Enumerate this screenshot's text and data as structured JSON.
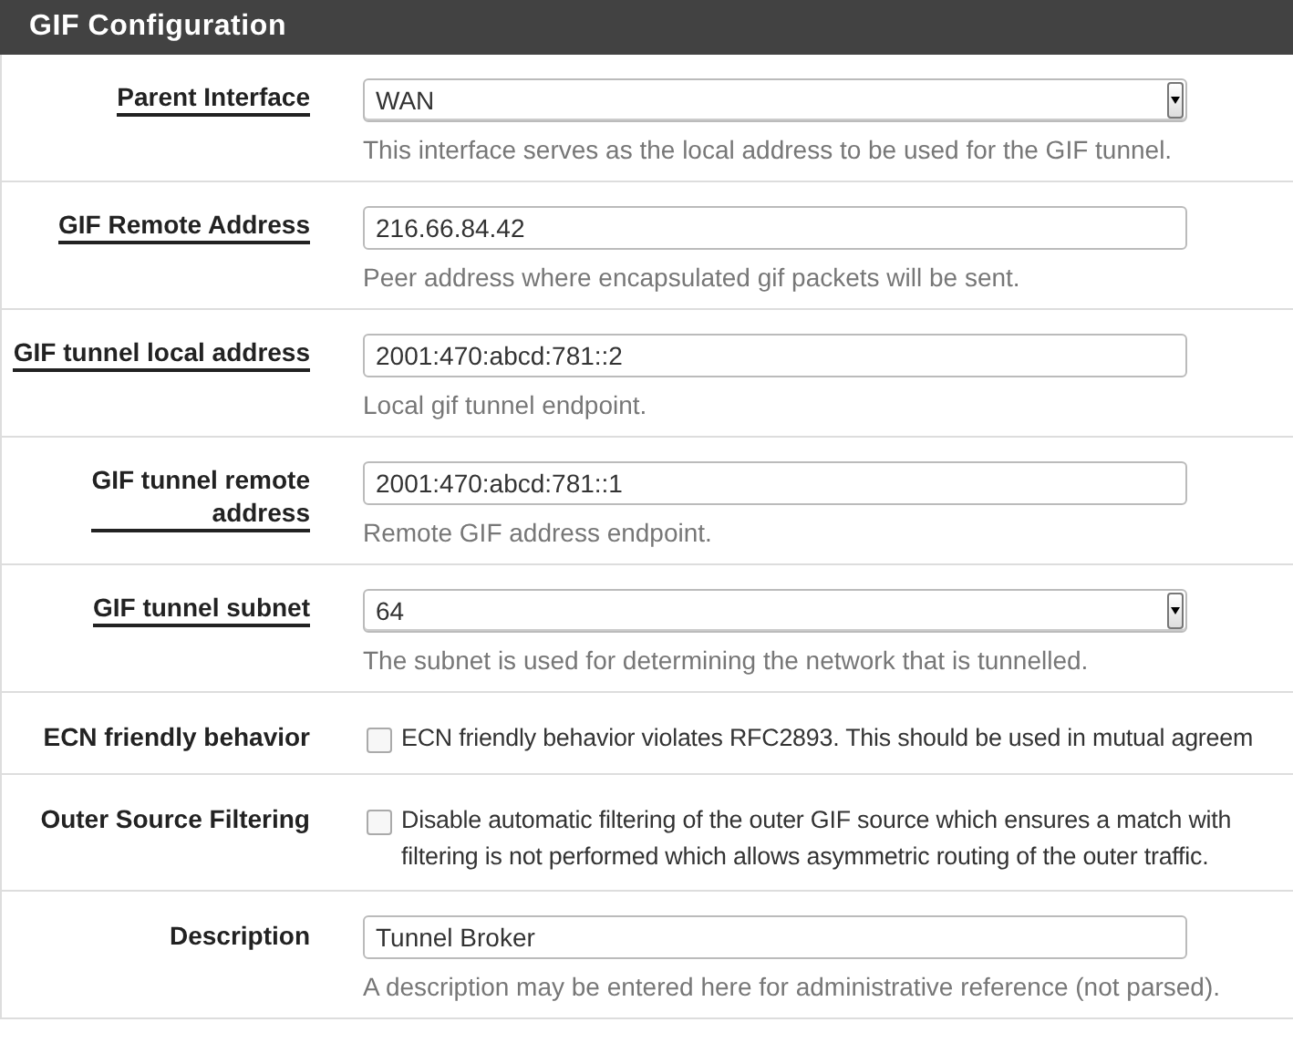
{
  "panel": {
    "title": "GIF Configuration"
  },
  "rows": [
    {
      "kind": "select",
      "label_lines": [
        "Parent Interface"
      ],
      "linked": true,
      "value": "WAN",
      "help": "This interface serves as the local address to be used for the GIF tunnel."
    },
    {
      "kind": "input",
      "label_lines": [
        "GIF Remote Address"
      ],
      "linked": true,
      "value": "216.66.84.42",
      "help": "Peer address where encapsulated gif packets will be sent."
    },
    {
      "kind": "input",
      "label_lines": [
        "GIF tunnel local address"
      ],
      "linked": true,
      "value": "2001:470:abcd:781::2",
      "help": "Local gif tunnel endpoint."
    },
    {
      "kind": "input",
      "label_lines": [
        "GIF tunnel remote",
        "address"
      ],
      "linked": true,
      "value": "2001:470:abcd:781::1",
      "help": "Remote GIF address endpoint."
    },
    {
      "kind": "select",
      "label_lines": [
        "GIF tunnel subnet"
      ],
      "linked": true,
      "value": "64",
      "help": "The subnet is used for determining the network that is tunnelled."
    },
    {
      "kind": "checkbox",
      "label_lines": [
        "ECN friendly behavior"
      ],
      "linked": false,
      "checked": false,
      "text_lines": [
        "ECN friendly behavior violates RFC2893. This should be used in mutual agreem"
      ]
    },
    {
      "kind": "checkbox",
      "label_lines": [
        "Outer Source Filtering"
      ],
      "linked": false,
      "checked": false,
      "text_lines": [
        "Disable automatic filtering of the outer GIF source which ensures a match with",
        "filtering is not performed which allows asymmetric routing of the outer traffic."
      ]
    },
    {
      "kind": "input",
      "label_lines": [
        "Description"
      ],
      "linked": false,
      "value": "Tunnel Broker",
      "help": "A description may be entered here for administrative reference (not parsed)."
    }
  ]
}
